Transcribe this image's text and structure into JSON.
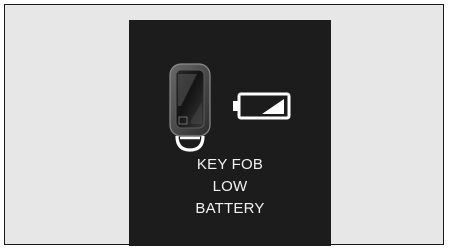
{
  "display": {
    "warning": {
      "lines": [
        "KEY FOB",
        "LOW",
        "BATTERY"
      ]
    },
    "icons": {
      "fob": "key-fob-icon",
      "battery": "low-battery-icon"
    },
    "colors": {
      "screen_background": "#1c1c1c",
      "text": "#f2f2f2",
      "panel_background": "#e7e7e7"
    }
  }
}
